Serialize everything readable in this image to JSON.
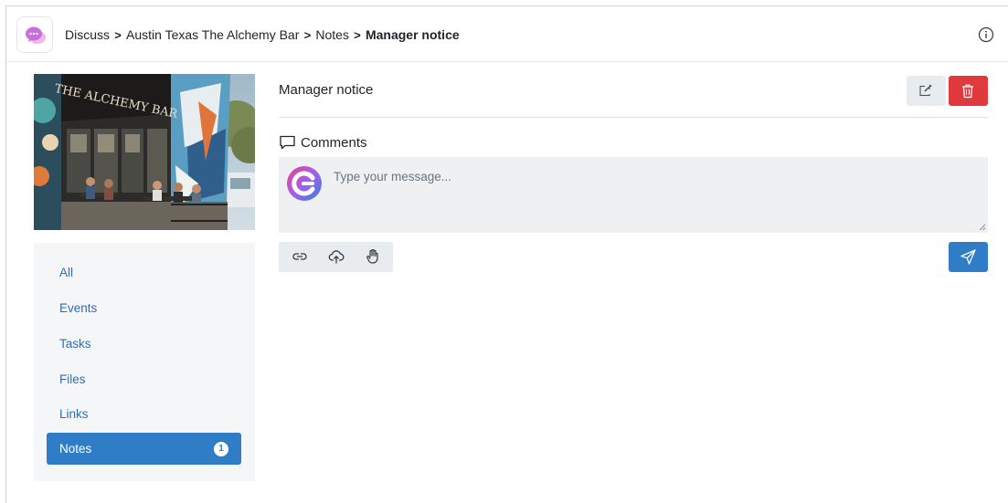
{
  "breadcrumb": {
    "items": [
      "Discuss",
      "Austin Texas The Alchemy Bar",
      "Notes"
    ],
    "separator": ">",
    "current": "Manager notice"
  },
  "venue_image": {
    "sign_text": "THE ALCHEMY BAR"
  },
  "sidebar": {
    "items": [
      {
        "label": "All"
      },
      {
        "label": "Events"
      },
      {
        "label": "Tasks"
      },
      {
        "label": "Files"
      },
      {
        "label": "Links"
      },
      {
        "label": "Notes",
        "badge": "1",
        "active": true
      }
    ]
  },
  "note": {
    "title": "Manager notice"
  },
  "comments": {
    "heading": "Comments",
    "placeholder": "Type your message..."
  },
  "icons": {
    "header": [
      "app-logo-icon",
      "info-icon"
    ],
    "actions": [
      "edit-icon",
      "trash-icon"
    ],
    "comments": [
      "comment-icon"
    ],
    "toolbar": [
      "link-icon",
      "upload-cloud-icon",
      "hand-icon"
    ],
    "send": "send-icon"
  },
  "colors": {
    "primary": "#2f7cc7",
    "danger": "#e0393e",
    "sidebar_bg": "#f5f6f8",
    "link": "#2a6fb8",
    "app_logo": "#c86ee0"
  }
}
